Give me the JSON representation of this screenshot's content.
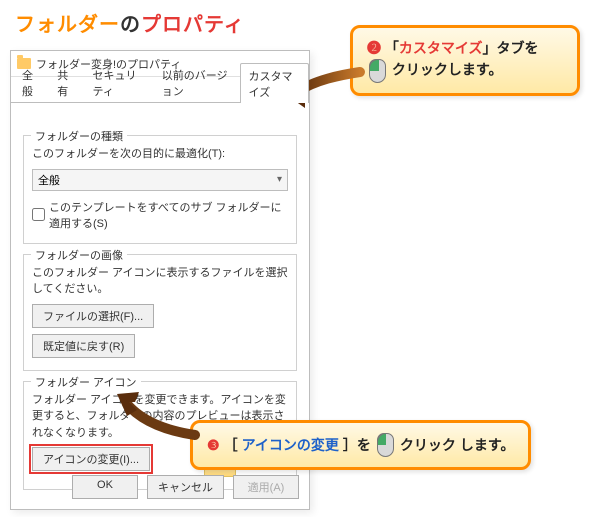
{
  "page_title": {
    "t1": "フォルダー",
    "t2": "の",
    "t3": "プロパティ"
  },
  "window": {
    "title": "フォルダー変身!のプロパティ",
    "tabs": [
      "全般",
      "共有",
      "セキュリティ",
      "以前のバージョン",
      "カスタマイズ"
    ],
    "active_tab_index": 4,
    "group_type": {
      "title": "フォルダーの種類",
      "desc": "このフォルダーを次の目的に最適化(T):",
      "select_value": "全般",
      "checkbox_label": "このテンプレートをすべてのサブ フォルダーに適用する(S)"
    },
    "group_image": {
      "title": "フォルダーの画像",
      "desc": "このフォルダー アイコンに表示するファイルを選択してください。",
      "btn_choose": "ファイルの選択(F)...",
      "btn_reset": "既定値に戻す(R)"
    },
    "group_icon": {
      "title": "フォルダー アイコン",
      "desc": "フォルダー アイコンを変更できます。アイコンを変更すると、フォルダーの内容のプレビューは表示されなくなります。",
      "btn_change": "アイコンの変更(I)..."
    },
    "buttons": {
      "ok": "OK",
      "cancel": "キャンセル",
      "apply": "適用(A)"
    }
  },
  "callouts": {
    "c1": {
      "num": "❷",
      "pre": "「",
      "kw": "カスタマイズ",
      "post": "」タブを",
      "click_word": "クリック",
      "tail": "します。"
    },
    "c2": {
      "num": "❸",
      "pre": "［",
      "kw": "アイコンの変更",
      "post": "］を",
      "click_word": "クリック",
      "tail": "します。"
    }
  }
}
